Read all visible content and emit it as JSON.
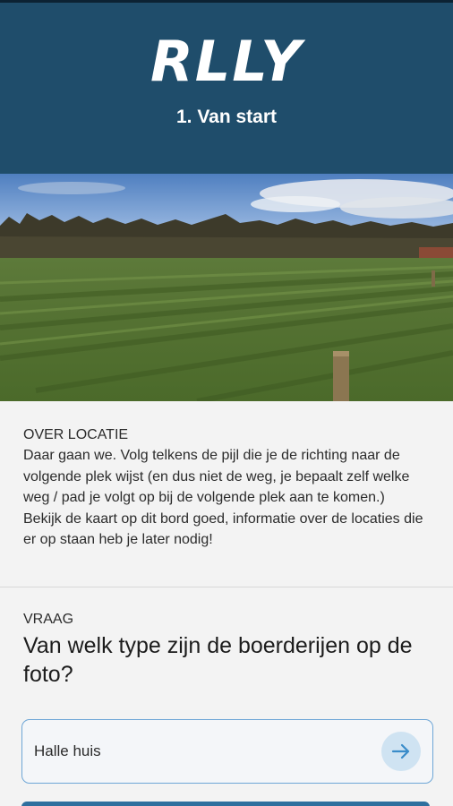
{
  "header": {
    "logo_text": "RLLY",
    "step_title": "1. Van start",
    "background_color": "#1f4d6b"
  },
  "photo": {
    "icon": "landscape-photo-field"
  },
  "info": {
    "label": "OVER LOCATIE",
    "paragraphs": [
      "Daar gaan we. Volg telkens de pijl die je de richting naar de volgende plek wijst (en dus niet de weg, je bepaalt zelf welke weg / pad je volgt op bij de volgende plek aan te komen.)",
      "Bekijk de kaart op dit bord goed, informatie over de locaties die er op staan heb je later nodig!"
    ]
  },
  "question": {
    "label": "VRAAG",
    "text": "Van welk type zijn de boerderijen op de foto?",
    "answer_value": "Halle huis",
    "submit_icon": "arrow-right-icon",
    "accent_color": "#3a8cc9"
  }
}
